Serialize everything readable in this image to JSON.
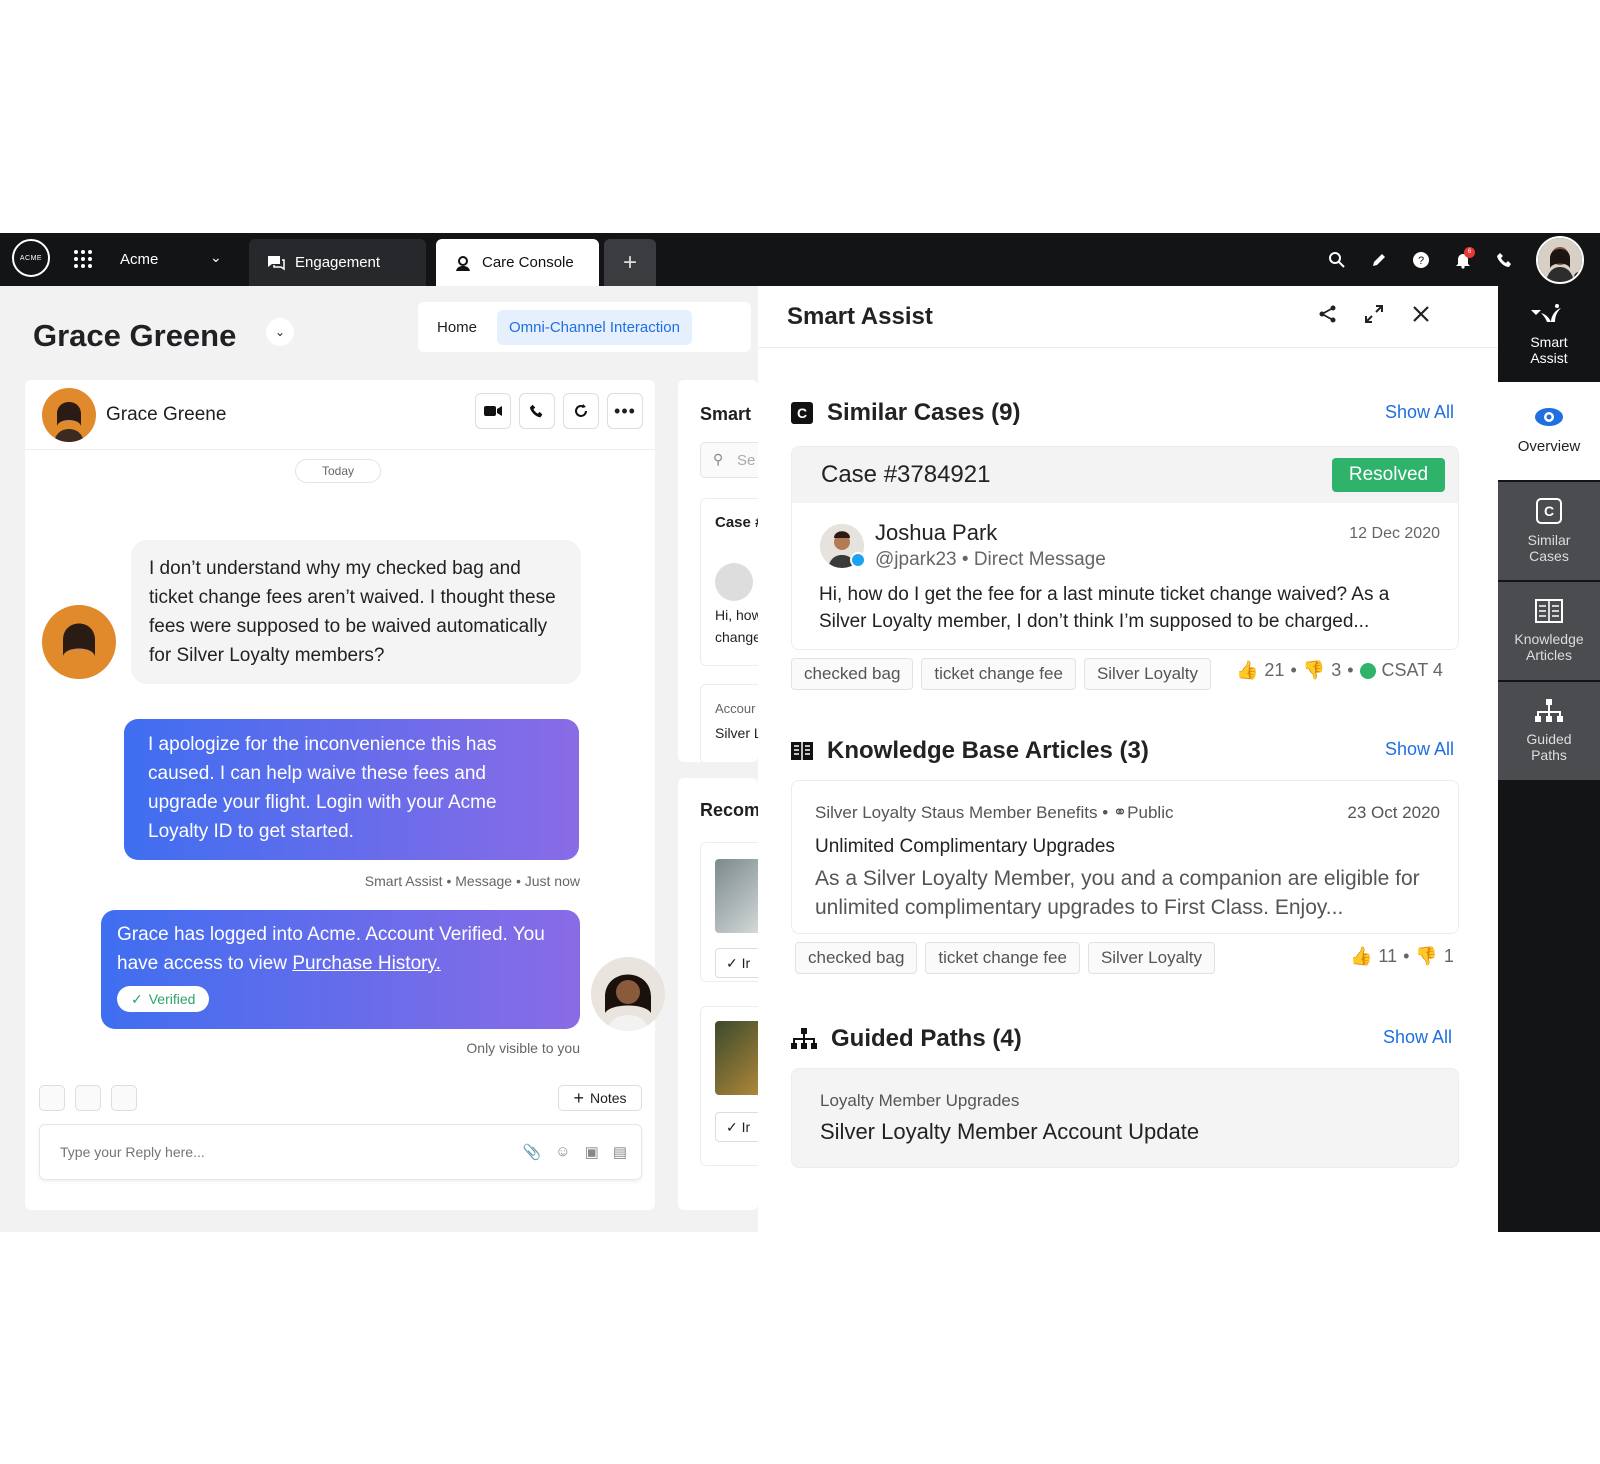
{
  "topbar": {
    "logo": "ACME",
    "brand": "Acme",
    "tabs": [
      {
        "label": "Engagement"
      },
      {
        "label": "Care Console"
      }
    ],
    "add_tab": "+",
    "notification_count": "6"
  },
  "page": {
    "title": "Grace Greene",
    "breadcrumbs": [
      "Home",
      "Omni-Channel Interaction"
    ]
  },
  "chat": {
    "contact_name": "Grace Greene",
    "date_divider": "Today",
    "messages": [
      {
        "text": "I don’t understand why my checked bag and ticket change fees aren’t waived.  I thought these fees were supposed to be waived automatically for Silver Loyalty members?"
      },
      {
        "text": "I apologize for the inconvenience this has caused. I can help waive these fees and upgrade your flight. Login with your Acme Loyalty ID to get started.",
        "meta": "Smart Assist • Message • Just now"
      },
      {
        "text": "Grace has logged into Acme. Account Verified. You have access to view ",
        "link": "Purchase History.",
        "badge": "Verified",
        "meta": "Only visible to you"
      }
    ],
    "notes_label": "Notes",
    "reply_placeholder": "Type your Reply here..."
  },
  "middle": {
    "title": "Smart",
    "search_placeholder": "Se",
    "case_label": "Case #",
    "case_snippet_1": "Hi, how",
    "case_snippet_2": "change",
    "account_label": "Accour",
    "account_value": "Silver L",
    "recommend_label": "Recom",
    "btn_1": "Ir",
    "btn_2": "Ir"
  },
  "smart_assist": {
    "title": "Smart Assist",
    "show_all": "Show All",
    "similar_cases": {
      "title": "Similar Cases (9)",
      "case_id": "Case #3784921",
      "status": "Resolved",
      "person": "Joshua Park",
      "handle": "@jpark23 • Direct Message",
      "date": "12 Dec 2020",
      "body": "Hi, how do I get the fee for a last minute ticket change waived? As a Silver Loyalty member, I don’t think I’m supposed to be charged...",
      "tags": [
        "checked bag",
        "ticket change fee",
        "Silver Loyalty"
      ],
      "likes": "21",
      "dislikes": "3",
      "csat": "CSAT 4"
    },
    "knowledge": {
      "title": "Knowledge Base Articles (3)",
      "source": "Silver Loyalty Staus Member Benefits",
      "visibility": "Public",
      "date": "23 Oct 2020",
      "heading": "Unlimited Complimentary Upgrades",
      "body": "As a Silver Loyalty Member, you and a companion are eligible for unlimited complimentary upgrades to First Class. Enjoy...",
      "tags": [
        "checked bag",
        "ticket change fee",
        "Silver Loyalty"
      ],
      "likes": "11",
      "dislikes": "1"
    },
    "guided": {
      "title": "Guided Paths (4)",
      "category": "Loyalty Member Upgrades",
      "path": "Silver Loyalty Member Account Update"
    }
  },
  "rail": {
    "items": [
      {
        "label": "Smart Assist"
      },
      {
        "label": "Overview"
      },
      {
        "label": "Similar Cases"
      },
      {
        "label": "Knowledge Articles"
      },
      {
        "label": "Guided Paths"
      }
    ]
  },
  "colors": {
    "accent": "#1f6fe0",
    "resolved": "#2fb36b",
    "topbar": "#131416"
  }
}
